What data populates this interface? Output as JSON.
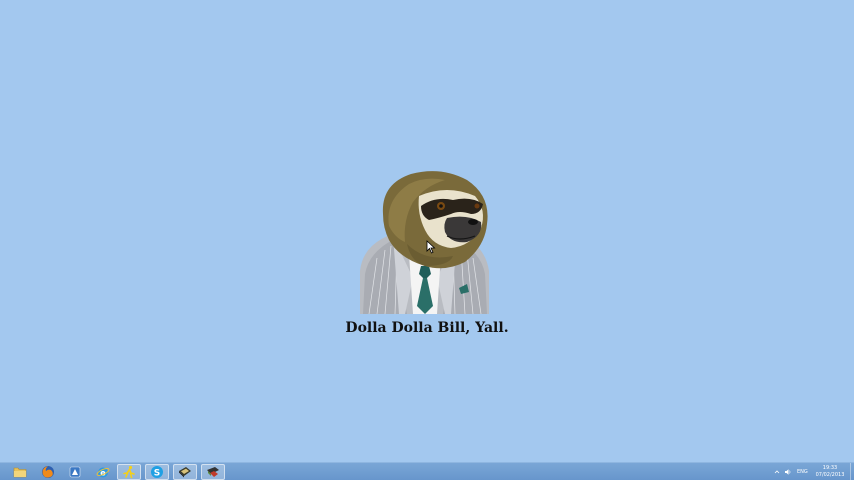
{
  "desktop": {
    "caption": "Dolla Dolla Bill, Yall.",
    "background_color": "#a3c8ef",
    "wallpaper_icon": "sloth-in-suit-icon"
  },
  "taskbar": {
    "color": "#6d9bd0",
    "apps": [
      {
        "name": "file-explorer",
        "icon": "folder-icon"
      },
      {
        "name": "firefox",
        "icon": "firefox-icon"
      },
      {
        "name": "app-3",
        "icon": "app-icon"
      },
      {
        "name": "internet-explorer",
        "icon": "ie-icon"
      },
      {
        "name": "app-5",
        "icon": "runner-icon"
      },
      {
        "name": "skype",
        "icon": "skype-icon"
      },
      {
        "name": "app-7",
        "icon": "app-icon"
      },
      {
        "name": "app-8",
        "icon": "app-icon"
      }
    ],
    "tray": {
      "language": "ENG",
      "time": "19:33",
      "date": "07/02/2013"
    }
  }
}
